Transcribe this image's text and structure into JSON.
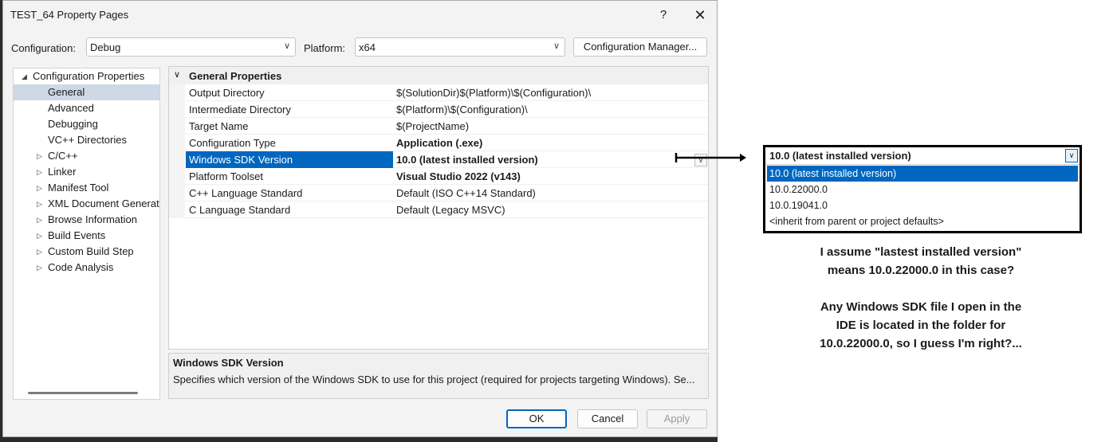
{
  "window": {
    "title": "TEST_64 Property Pages",
    "help": "?",
    "close": "✕"
  },
  "toolbar": {
    "configuration_label": "Configuration:",
    "configuration_value": "Debug",
    "platform_label": "Platform:",
    "platform_value": "x64",
    "config_manager_button": "Configuration Manager..."
  },
  "tree": {
    "root": "Configuration Properties",
    "items": [
      "General",
      "Advanced",
      "Debugging",
      "VC++ Directories",
      "C/C++",
      "Linker",
      "Manifest Tool",
      "XML Document Generat",
      "Browse Information",
      "Build Events",
      "Custom Build Step",
      "Code Analysis"
    ]
  },
  "grid": {
    "section": "General Properties",
    "rows": [
      {
        "name": "Output Directory",
        "value": "$(SolutionDir)$(Platform)\\$(Configuration)\\"
      },
      {
        "name": "Intermediate Directory",
        "value": "$(Platform)\\$(Configuration)\\"
      },
      {
        "name": "Target Name",
        "value": "$(ProjectName)"
      },
      {
        "name": "Configuration Type",
        "value": "Application (.exe)"
      },
      {
        "name": "Windows SDK Version",
        "value": "10.0 (latest installed version)"
      },
      {
        "name": "Platform Toolset",
        "value": "Visual Studio 2022 (v143)"
      },
      {
        "name": "C++ Language Standard",
        "value": "Default (ISO C++14 Standard)"
      },
      {
        "name": "C Language Standard",
        "value": "Default (Legacy MSVC)"
      }
    ]
  },
  "description": {
    "title": "Windows SDK Version",
    "text": "Specifies which version of the Windows SDK to use for this project (required for projects targeting Windows). Se..."
  },
  "buttons": {
    "ok": "OK",
    "cancel": "Cancel",
    "apply": "Apply"
  },
  "dropdown": {
    "selected": "10.0 (latest installed version)",
    "options": [
      "10.0 (latest installed version)",
      "10.0.22000.0",
      "10.0.19041.0",
      "<inherit from parent or project defaults>"
    ]
  },
  "annotation": {
    "line1": "I assume \"lastest installed version\"",
    "line2": "means 10.0.22000.0 in this case?",
    "line3": "Any Windows SDK file I open in the",
    "line4": "IDE is located in the folder for",
    "line5": "10.0.22000.0, so I guess I'm right?..."
  },
  "colors": {
    "accent": "#0067c0",
    "tree_selection": "#cfd8e5"
  }
}
